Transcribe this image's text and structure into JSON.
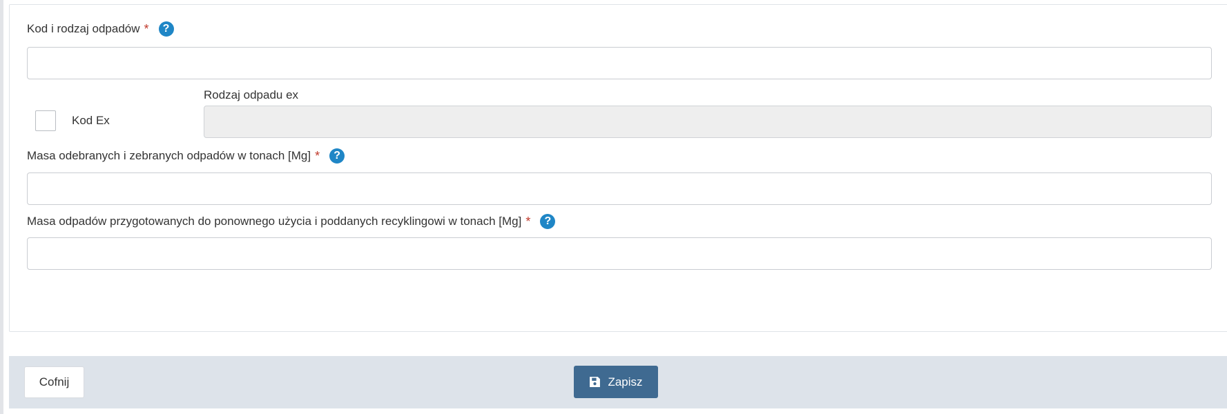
{
  "form": {
    "waste_code": {
      "label": "Kod i rodzaj odpadów",
      "required_mark": "*",
      "help_glyph": "?",
      "value": ""
    },
    "code_ex": {
      "checkbox_label": "Kod Ex",
      "checked": false,
      "ex_type_label": "Rodzaj odpadu ex",
      "ex_type_value": ""
    },
    "mass_collected": {
      "label": "Masa odebranych i zebranych odpadów w tonach [Mg]",
      "required_mark": "*",
      "help_glyph": "?",
      "value": ""
    },
    "mass_recycled": {
      "label": "Masa odpadów przygotowanych do ponownego użycia i poddanych recyklingowi w tonach [Mg]",
      "required_mark": "*",
      "help_glyph": "?",
      "value": ""
    }
  },
  "actions": {
    "back_label": "Cofnij",
    "save_label": "Zapisz",
    "save_icon": "floppy-disk-icon"
  },
  "colors": {
    "required": "#c0392b",
    "help": "#1f86c6",
    "primary_button": "#3f6a91",
    "actions_bar": "#dde3ea"
  }
}
